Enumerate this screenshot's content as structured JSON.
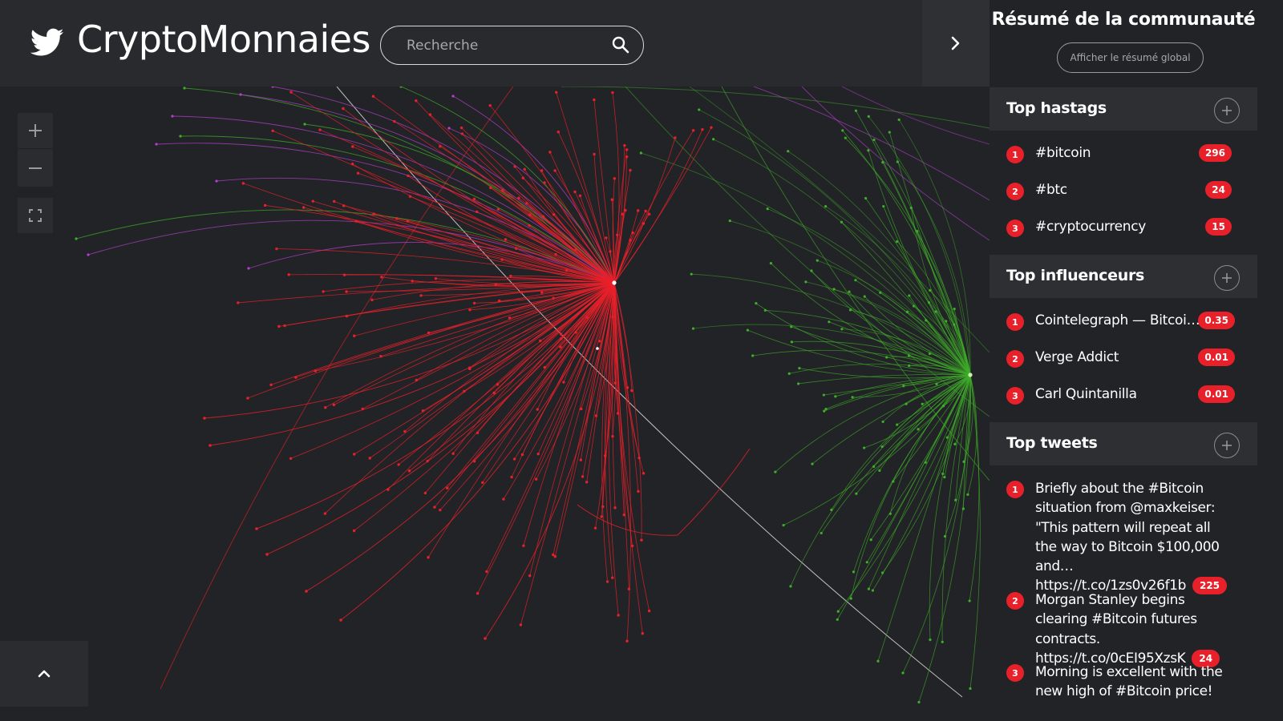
{
  "header": {
    "app_title": "CryptoMonnaies",
    "brand_icon": "twitter-bird-icon",
    "search": {
      "placeholder": "Recherche",
      "value": ""
    }
  },
  "graph": {
    "controls": {
      "zoom_in": "+",
      "zoom_out": "−"
    },
    "colors": {
      "cluster_red": "#e8202a",
      "cluster_green": "#3fae2a",
      "edges_purple": "#b43fd0",
      "edges_white": "#d0d0d0"
    }
  },
  "panel": {
    "title": "Résumé de la communauté",
    "global_button": "Afficher le résumé global",
    "sections": {
      "hashtags": {
        "title": "Top hastags",
        "items": [
          {
            "rank": "1",
            "label": "#bitcoin",
            "count": "296"
          },
          {
            "rank": "2",
            "label": "#btc",
            "count": "24"
          },
          {
            "rank": "3",
            "label": "#cryptocurrency",
            "count": "15"
          }
        ]
      },
      "influencers": {
        "title": "Top influenceurs",
        "items": [
          {
            "rank": "1",
            "label": "Cointelegraph — Bitcoi…",
            "count": "0.35"
          },
          {
            "rank": "2",
            "label": "Verge Addict",
            "count": "0.01"
          },
          {
            "rank": "3",
            "label": "Carl Quintanilla",
            "count": "0.01"
          }
        ]
      },
      "tweets": {
        "title": "Top tweets",
        "items": [
          {
            "rank": "1",
            "text": "Briefly about the #Bitcoin situation from @maxkeiser: \"This pattern will repeat all the way to Bitcoin $100,000 and… https://t.co/1zs0v26f1b",
            "count": "225"
          },
          {
            "rank": "2",
            "text": "Morgan Stanley begins clearing #Bitcoin futures contracts. https://t.co/0cEI95XzsK",
            "count": "24"
          },
          {
            "rank": "3",
            "text": "Morning is excellent with the new high of #Bitcoin price!",
            "count": ""
          }
        ]
      }
    }
  },
  "accent_color": "#e8202a"
}
